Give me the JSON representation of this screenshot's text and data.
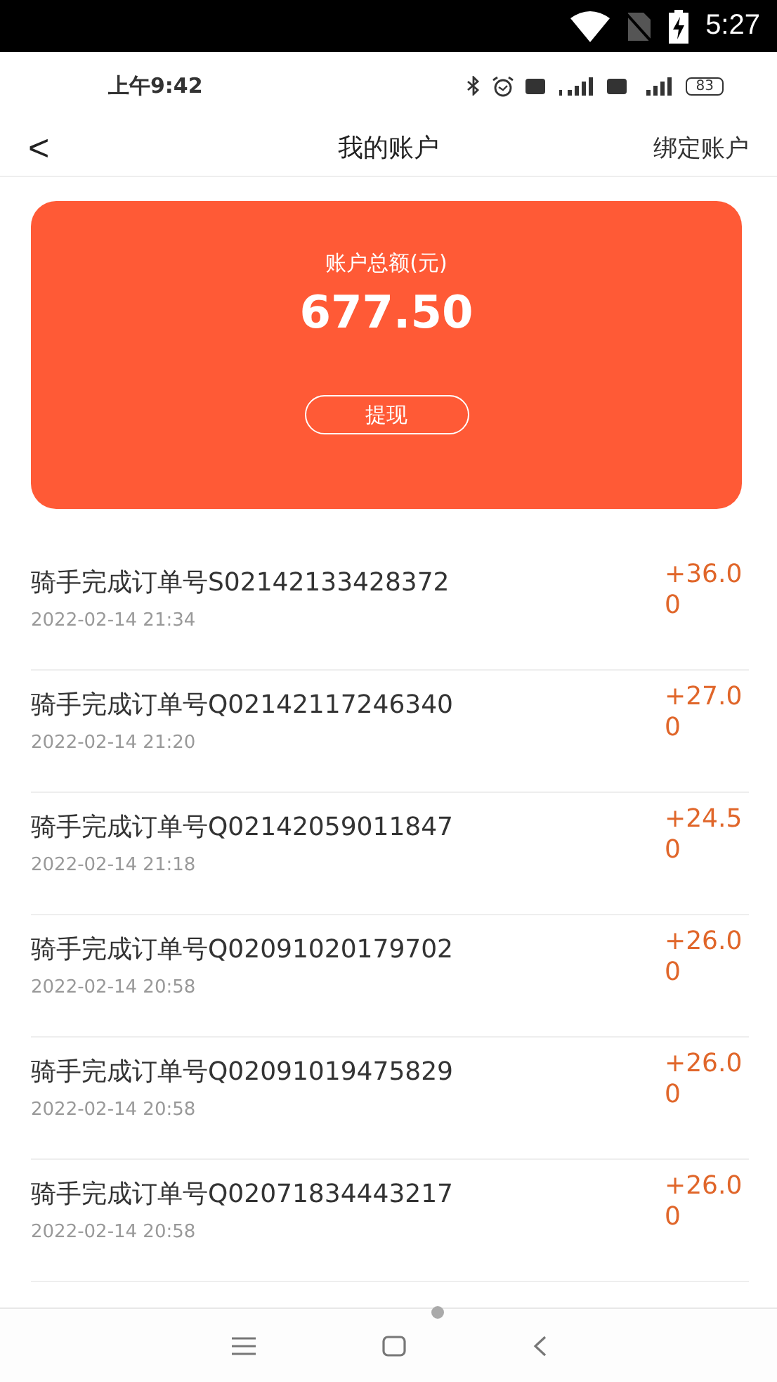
{
  "system_status_bar": {
    "time": "5:27"
  },
  "phone_status_bar": {
    "time": "上午9:42",
    "battery": "83"
  },
  "header": {
    "back": "<",
    "title": "我的账户",
    "action": "绑定账户"
  },
  "balance_card": {
    "label": "账户总额(元)",
    "amount": "677.50",
    "button": "提现"
  },
  "transactions": [
    {
      "title": "骑手完成订单号S02142133428372",
      "date": "2022-02-14 21:34",
      "amount": "+36.00"
    },
    {
      "title": "骑手完成订单号Q02142117246340",
      "date": "2022-02-14 21:20",
      "amount": "+27.00"
    },
    {
      "title": "骑手完成订单号Q02142059011847",
      "date": "2022-02-14 21:18",
      "amount": "+24.50"
    },
    {
      "title": "骑手完成订单号Q02091020179702",
      "date": "2022-02-14 20:58",
      "amount": "+26.00"
    },
    {
      "title": "骑手完成订单号Q02091019475829",
      "date": "2022-02-14 20:58",
      "amount": "+26.00"
    },
    {
      "title": "骑手完成订单号Q02071834443217",
      "date": "2022-02-14 20:58",
      "amount": "+26.00"
    }
  ]
}
